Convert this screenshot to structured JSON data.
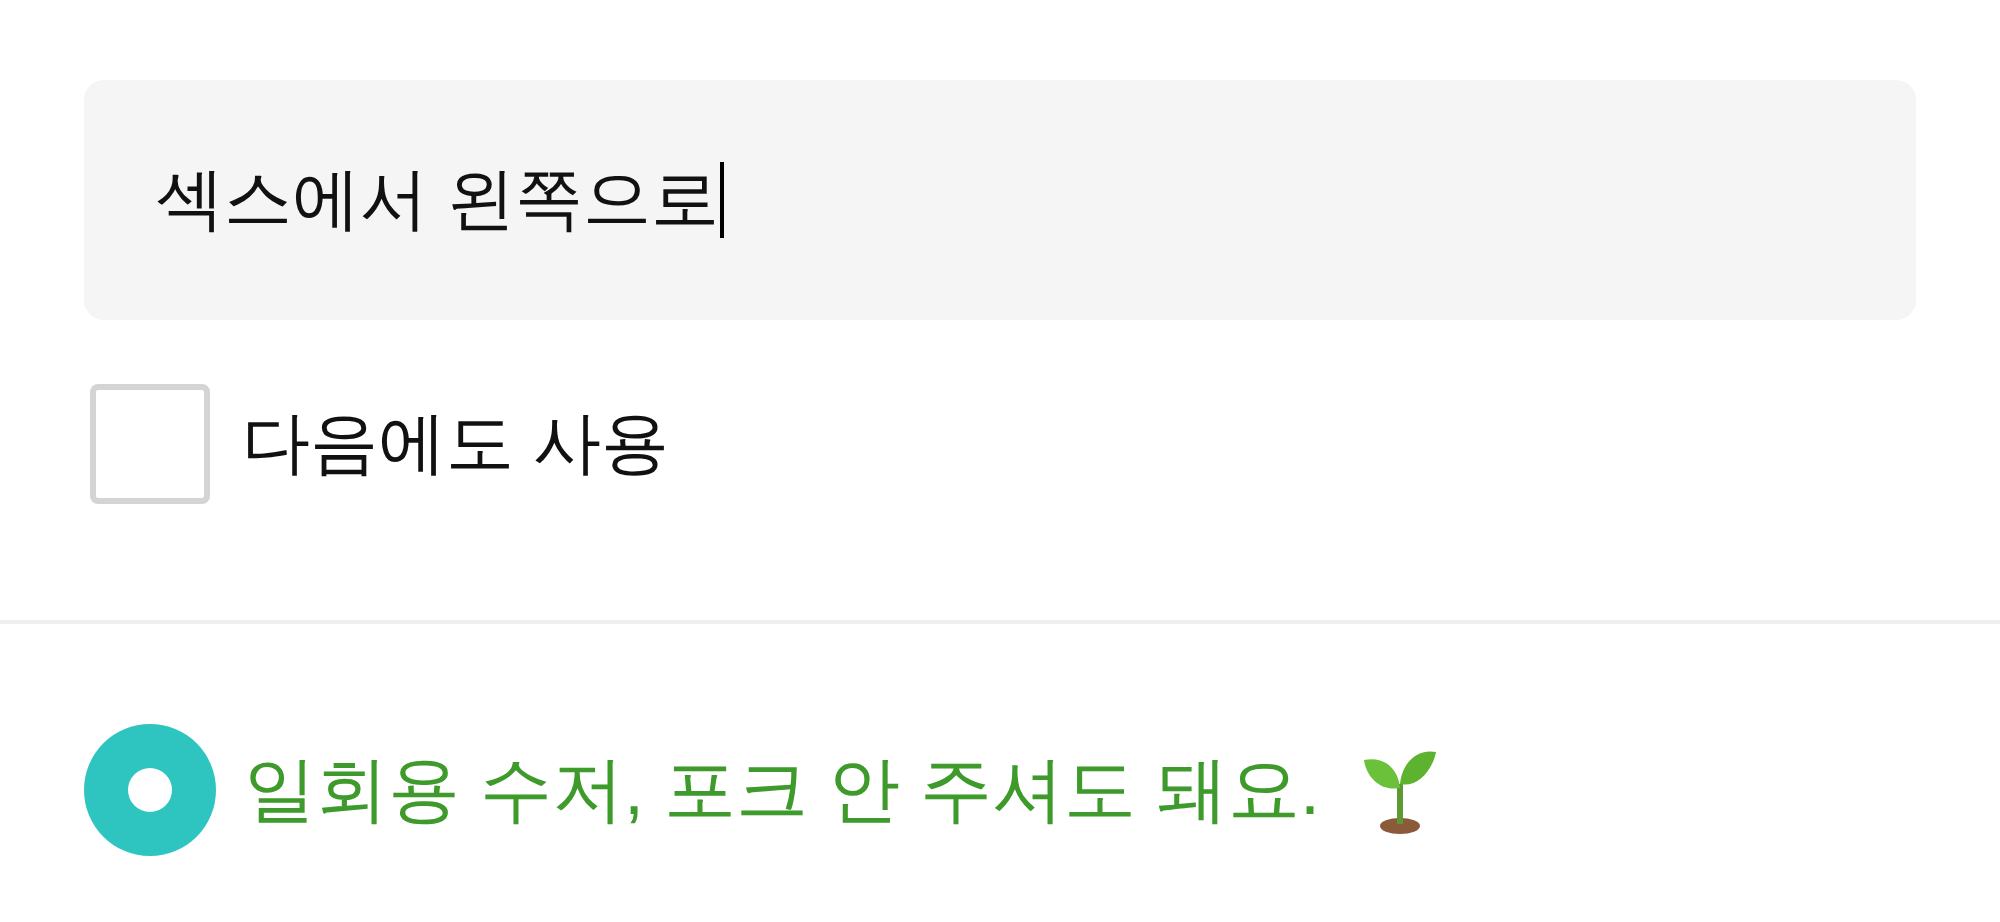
{
  "request_field": {
    "value": "섹스에서 왼쪽으로",
    "focused": true
  },
  "remember_checkbox": {
    "label": "다음에도 사용",
    "checked": false
  },
  "options": [
    {
      "label": "일회용 수저, 포크 안 주셔도 돼요.",
      "selected": true
    }
  ]
}
